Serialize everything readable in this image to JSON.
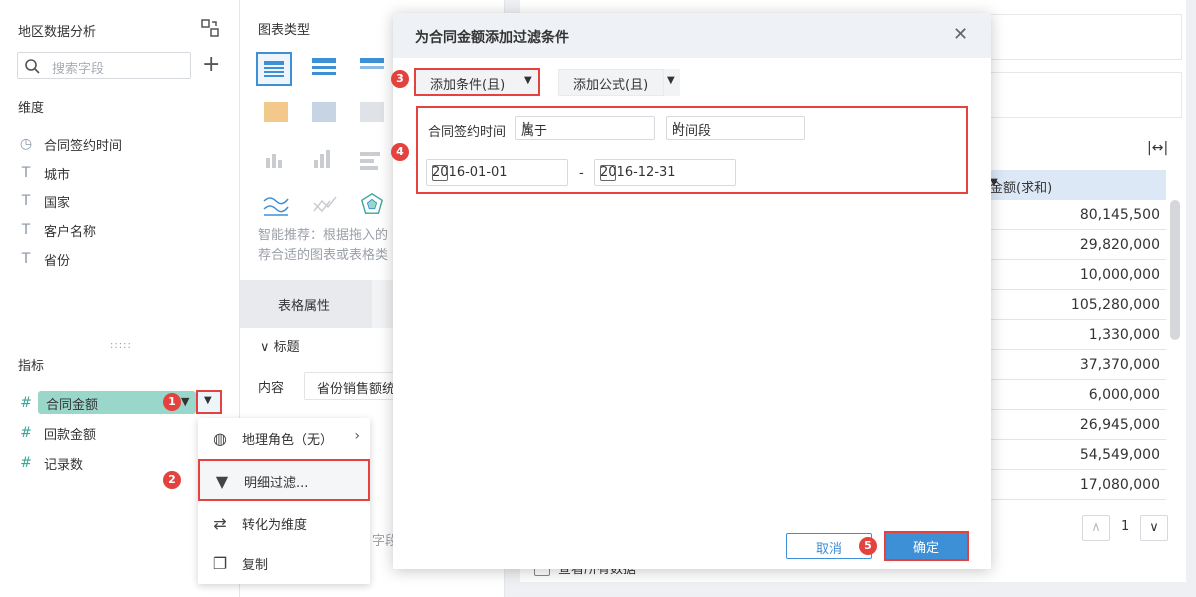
{
  "left_panel": {
    "title": "地区数据分析",
    "search_placeholder": "搜索字段",
    "dimensions_label": "维度",
    "dimensions": [
      {
        "icon": "clock-icon",
        "glyph": "◷",
        "label": "合同签约时间"
      },
      {
        "icon": "text-type-icon",
        "glyph": "T",
        "label": "城市"
      },
      {
        "icon": "text-type-icon",
        "glyph": "T",
        "label": "国家"
      },
      {
        "icon": "text-type-icon",
        "glyph": "T",
        "label": "客户名称"
      },
      {
        "icon": "text-type-icon",
        "glyph": "T",
        "label": "省份"
      }
    ],
    "metrics_label": "指标",
    "metrics": [
      {
        "label": "合同金额"
      },
      {
        "label": "回款金额"
      },
      {
        "label": "记录数"
      }
    ]
  },
  "context_menu": {
    "items": [
      {
        "icon": "globe-icon",
        "label": "地理角色（无）"
      },
      {
        "icon": "filter-icon",
        "label": "明细过滤..."
      },
      {
        "icon": "swap-icon",
        "label": "转化为维度"
      },
      {
        "icon": "copy-icon",
        "label": "复制"
      }
    ]
  },
  "chart_panel": {
    "title": "图表类型",
    "hint_line1": "智能推荐：根据拖入的",
    "hint_line2": "荐合适的图表或表格类",
    "tab_label": "表格属性",
    "section_title": "标题",
    "content_label": "内容",
    "content_value": "省份销售额统",
    "cut_text": "字段"
  },
  "table": {
    "header": "金额(求和)",
    "rows": [
      "80,145,500",
      "29,820,000",
      "10,000,000",
      "105,280,000",
      "1,330,000",
      "37,370,000",
      "6,000,000",
      "26,945,000",
      "54,549,000",
      "17,080,000"
    ],
    "page": "1",
    "view_all": "查看所有数据"
  },
  "dialog": {
    "title": "为合同金额添加过滤条件",
    "add_condition": "添加条件(且)",
    "add_formula": "添加公式(且)",
    "field": "合同签约时间",
    "operator": "属于",
    "range_type": "时间段",
    "start_date": "2016-01-01",
    "date_sep": "-",
    "end_date": "2016-12-31",
    "cancel": "取消",
    "ok": "确定"
  },
  "badges": [
    "1",
    "2",
    "3",
    "4",
    "5"
  ],
  "colors": {
    "accent": "#3d8fd6",
    "highlight": "#e3423f",
    "chip": "#9ad7cb"
  }
}
